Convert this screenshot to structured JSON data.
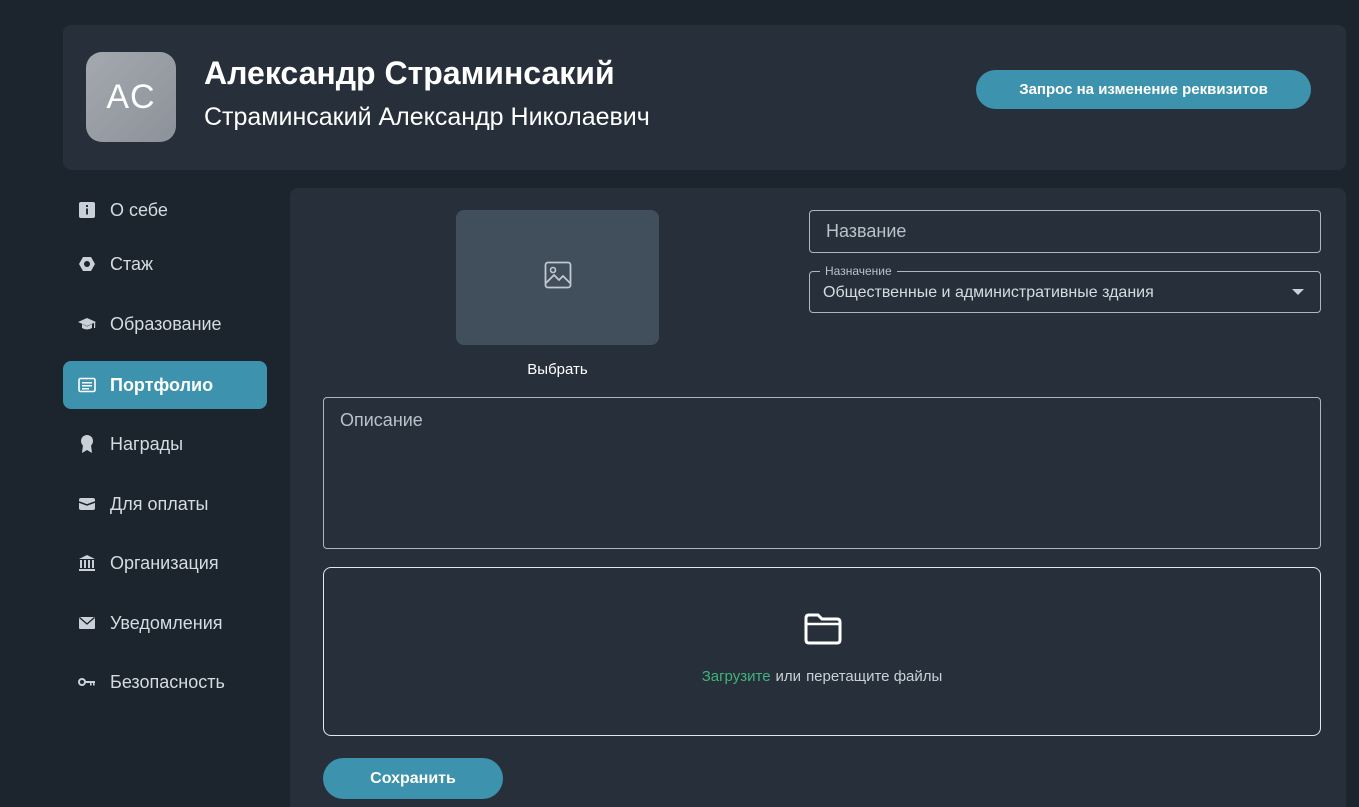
{
  "header": {
    "avatar_initials": "AC",
    "user_name": "Александр Страминсакий",
    "user_fullname": "Страминсакий Александр Николаевич",
    "request_button_label": "Запрос на изменение реквизитов"
  },
  "sidebar": {
    "items": [
      {
        "label": "О себе",
        "icon": "info-icon",
        "active": false
      },
      {
        "label": "Стаж",
        "icon": "hexagon-icon",
        "active": false
      },
      {
        "label": "Образование",
        "icon": "graduation-cap-icon",
        "active": false
      },
      {
        "label": "Портфолио",
        "icon": "portfolio-icon",
        "active": true
      },
      {
        "label": "Награды",
        "icon": "award-icon",
        "active": false
      },
      {
        "label": "Для оплаты",
        "icon": "wallet-icon",
        "active": false
      },
      {
        "label": "Организация",
        "icon": "bank-icon",
        "active": false
      },
      {
        "label": "Уведомления",
        "icon": "envelope-icon",
        "active": false
      },
      {
        "label": "Безопасность",
        "icon": "key-icon",
        "active": false
      }
    ]
  },
  "form": {
    "image_choose_label": "Выбрать",
    "name_placeholder": "Название",
    "purpose_label": "Назначение",
    "purpose_value": "Общественные и административные здания",
    "description_placeholder": "Описание",
    "dropzone_upload_link": "Загрузите",
    "dropzone_or": "или",
    "dropzone_drag_text": "перетащите файлы",
    "save_button_label": "Сохранить"
  },
  "colors": {
    "accent": "#3d93ad",
    "upload_link": "#3fb37a",
    "background": "#1c252d",
    "card": "#27303a"
  }
}
